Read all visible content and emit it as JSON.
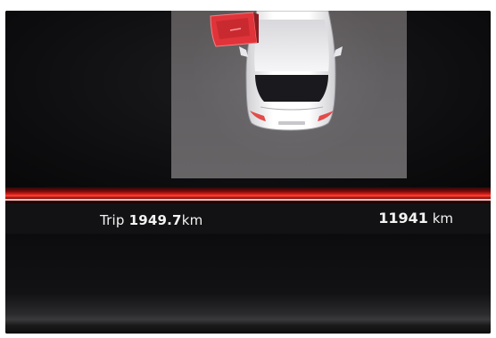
{
  "display": {
    "vehicle_status": "door-open",
    "trip": {
      "label": "Trip",
      "value": "1949.7",
      "unit": "km"
    },
    "odometer": {
      "value": "11941",
      "unit": "km"
    }
  },
  "colors": {
    "accent": "#e0231c",
    "door_highlight": "#e0343a",
    "text": "#f2f2f2"
  }
}
